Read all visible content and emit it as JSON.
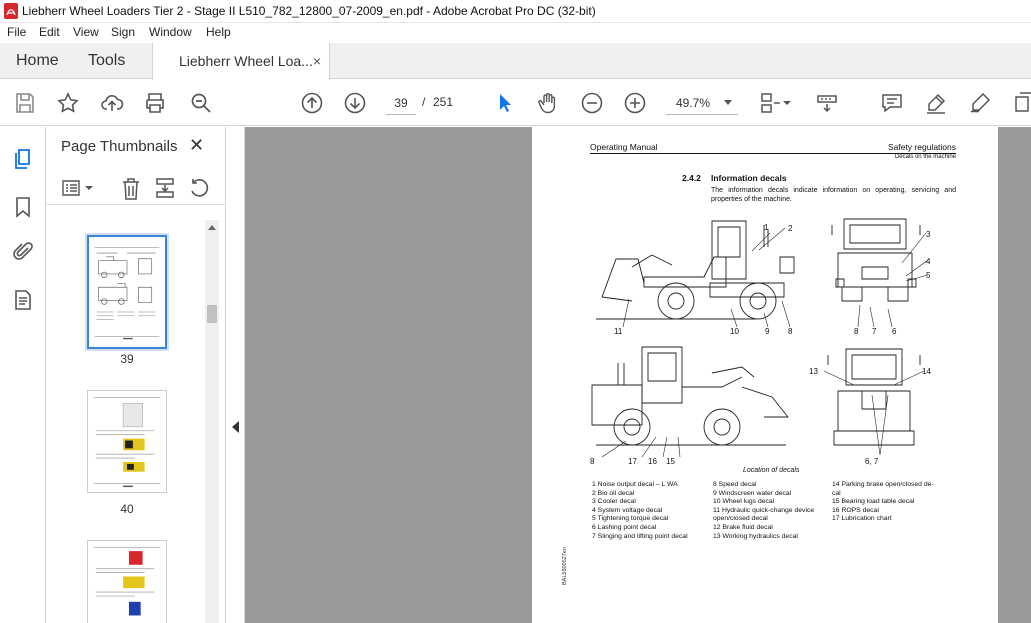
{
  "window": {
    "title": "Liebherr Wheel Loaders Tier 2 - Stage II L510_782_12800_07-2009_en.pdf - Adobe Acrobat Pro DC (32-bit)"
  },
  "menu": [
    "File",
    "Edit",
    "View",
    "Sign",
    "Window",
    "Help"
  ],
  "tabs": {
    "home": "Home",
    "tools": "Tools",
    "document": "Liebherr Wheel Loa...",
    "close": "×"
  },
  "toolbar": {
    "current_page": "39",
    "separator": "/",
    "total_pages": "251",
    "zoom": "49.7%"
  },
  "panel": {
    "title": "Page Thumbnails",
    "close": "✕",
    "thumbnails": [
      {
        "label": "39",
        "selected": true
      },
      {
        "label": "40",
        "selected": false
      },
      {
        "label": "",
        "selected": false
      }
    ]
  },
  "document_page": {
    "header_left": "Operating Manual",
    "header_right": "Safety regulations",
    "header_sub": "Decals on the machine",
    "section_number": "2.4.2",
    "section_title": "Information decals",
    "intro": "The information decals indicate information on operating, servicing and properties of the machine.",
    "figure_caption": "Location of decals",
    "callouts": {
      "top_side": [
        "1",
        "2",
        "11",
        "10",
        "9",
        "8"
      ],
      "top_rear": [
        "3",
        "4",
        "5",
        "8",
        "7",
        "6"
      ],
      "bottom_side": [
        "8",
        "17",
        "16",
        "15"
      ],
      "bottom_front": [
        "13",
        "14",
        "6, 7"
      ]
    },
    "legend_col1": [
      "1  Noise output decal – L WA",
      "2  Bio oil decal",
      "3  Cooler decal",
      "4  System voltage decal",
      "5  Tightening torque decal",
      "6  Lashing point decal",
      "7  Slinging and lifting point decal"
    ],
    "legend_col2": [
      "8  Speed decal",
      "9  Windscreen water decal",
      "10  Wheel lugs decal",
      "11  Hydraulic quick-change device",
      "     open/closed decal",
      "12  Brake fluid decal",
      "13  Working hydraulics decal"
    ],
    "legend_col3": [
      "14  Parking brake open/closed de-",
      "     cal",
      "15  Bearing load table decal",
      "16  ROPS decal",
      "17  Lubrication chart"
    ],
    "side_code": "BAL5500527en"
  },
  "colors": {
    "accent": "#3a83d5",
    "canvas": "#9a9a9a",
    "icon": "#555555",
    "active_icon": "#1473e6"
  }
}
